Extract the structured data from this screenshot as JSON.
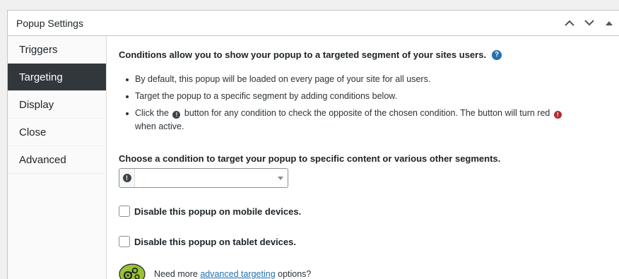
{
  "box": {
    "title": "Popup Settings",
    "actions": [
      {
        "icon": "chevron-up-icon"
      },
      {
        "icon": "chevron-down-icon"
      },
      {
        "icon": "triangle-up-icon"
      }
    ]
  },
  "tabs": [
    {
      "label": "Triggers",
      "active": false
    },
    {
      "label": "Targeting",
      "active": true
    },
    {
      "label": "Display",
      "active": false
    },
    {
      "label": "Close",
      "active": false
    },
    {
      "label": "Advanced",
      "active": false
    }
  ],
  "targeting": {
    "intro": "Conditions allow you to show your popup to a targeted segment of your sites users.",
    "help_icon_glyph": "?",
    "bullets": {
      "b1": "By default, this popup will be loaded on every page of your site for all users.",
      "b2": "Target the popup to a specific segment by adding conditions below.",
      "b3_pre": "Click the",
      "b3_mid": "button for any condition to check the opposite of the chosen condition. The button will turn red",
      "b3_post": "when active."
    },
    "excl_glyph": "!",
    "choose_label": "Choose a condition to target your popup to specific content or various other segments.",
    "condition_select_value": "",
    "disable_mobile": {
      "label": "Disable this popup on mobile devices.",
      "checked": false
    },
    "disable_tablet": {
      "label": "Disable this popup on tablet devices.",
      "checked": false
    },
    "promo": {
      "icon": "targeting-gear-icon",
      "pre": "Need more ",
      "link": "advanced targeting",
      "post": " options?"
    }
  },
  "colors": {
    "accent": "#2271b1",
    "active_tab_bg": "#32373c",
    "not_active_red": "#b32d2e",
    "promo_green": "#9bc234"
  }
}
